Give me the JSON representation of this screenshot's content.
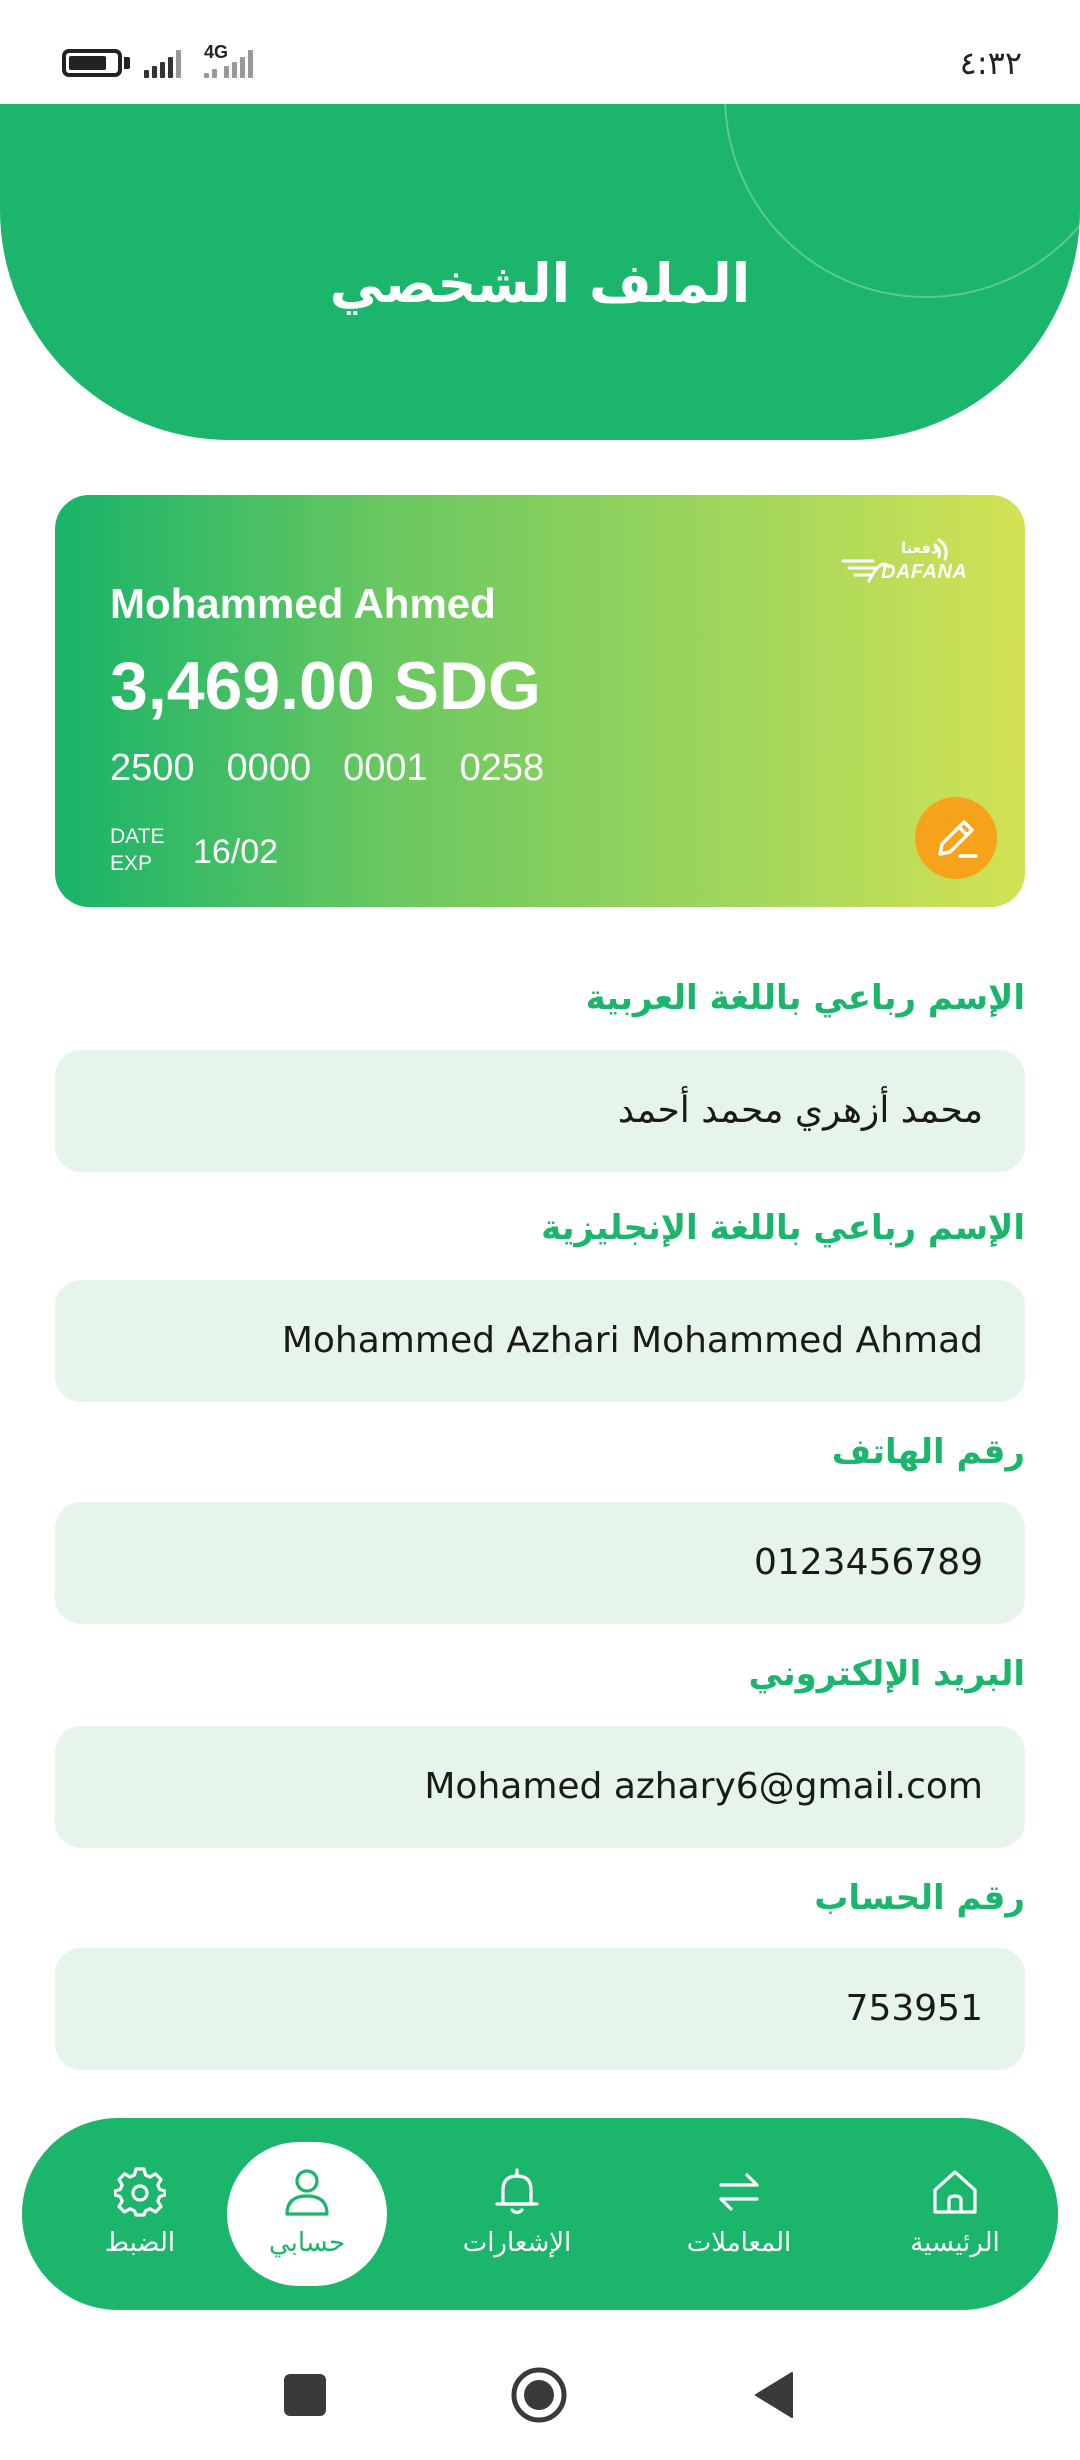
{
  "status_bar": {
    "time": "٤:٣٢",
    "network": "4G",
    "battery_level": 0.8
  },
  "header": {
    "title": "الملف الشخصي"
  },
  "card": {
    "holder_name": "Mohammed Ahmed",
    "balance": "3,469.00 SDG",
    "number_groups": [
      "2500",
      "0000",
      "0001",
      "0258"
    ],
    "exp_label_top": "DATE",
    "exp_label_bottom": "EXP",
    "exp_value": "16/02",
    "logo_text": "DAFANA",
    "logo_text_ar": "دفعنا",
    "edit_icon": "pencil-icon"
  },
  "fields": [
    {
      "label": "الإسم رباعي باللغة العربية",
      "value": "محمد أزهري محمد أحمد"
    },
    {
      "label": "الإسم رباعي باللغة الإنجليزية",
      "value": "Mohammed Azhari Mohammed Ahmad"
    },
    {
      "label": "رقم الهاتف",
      "value": "0123456789"
    },
    {
      "label": "البريد الإلكتروني",
      "value": "Mohamed azhary6@gmail.com"
    },
    {
      "label": "رقم الحساب",
      "value": "753951"
    }
  ],
  "bottom_nav": {
    "items": [
      {
        "label": "الضبط",
        "icon": "gear-icon"
      },
      {
        "label": "حسابي",
        "icon": "user-icon",
        "active": true
      },
      {
        "label": "الإشعارات",
        "icon": "bell-icon"
      },
      {
        "label": "المعاملات",
        "icon": "transfer-arrows-icon"
      },
      {
        "label": "الرئيسية",
        "icon": "home-icon"
      }
    ]
  },
  "colors": {
    "primary": "#1bb56b",
    "field_bg": "#e6f5e9",
    "edit_button": "#f7a21b"
  }
}
